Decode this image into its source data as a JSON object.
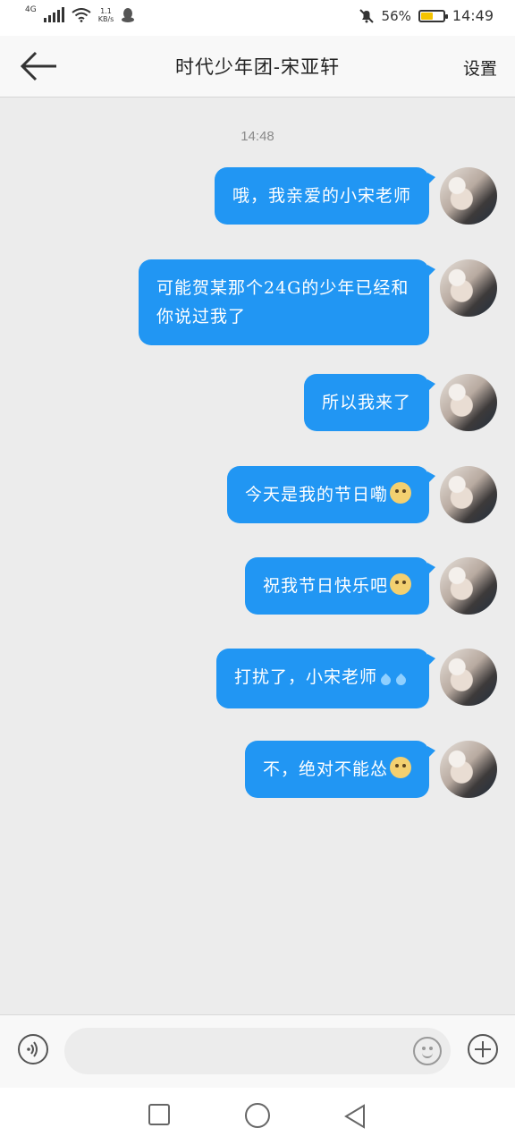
{
  "status": {
    "network": "4G",
    "speed_value": "1.1",
    "speed_unit": "KB/s",
    "battery": "56%",
    "battery_level": 0.56,
    "time": "14:49"
  },
  "header": {
    "title": "时代少年团-宋亚轩",
    "settings": "设置"
  },
  "chat": {
    "timestamp": "14:48",
    "messages": [
      {
        "text": "哦，我亲爱的小宋老师",
        "emoji": ""
      },
      {
        "text": "可能贺某那个24G的少年已经和你说过我了",
        "emoji": ""
      },
      {
        "text": "所以我来了",
        "emoji": ""
      },
      {
        "text": "今天是我的节日嘞",
        "emoji": "doge"
      },
      {
        "text": "祝我节日快乐吧",
        "emoji": "doge"
      },
      {
        "text": "打扰了，小宋老师",
        "emoji": "sweat-drops"
      },
      {
        "text": "不，绝对不能怂",
        "emoji": "doge"
      }
    ]
  },
  "input": {
    "value": "",
    "placeholder": ""
  },
  "colors": {
    "bubble": "#2196f3",
    "background": "#ececec"
  }
}
